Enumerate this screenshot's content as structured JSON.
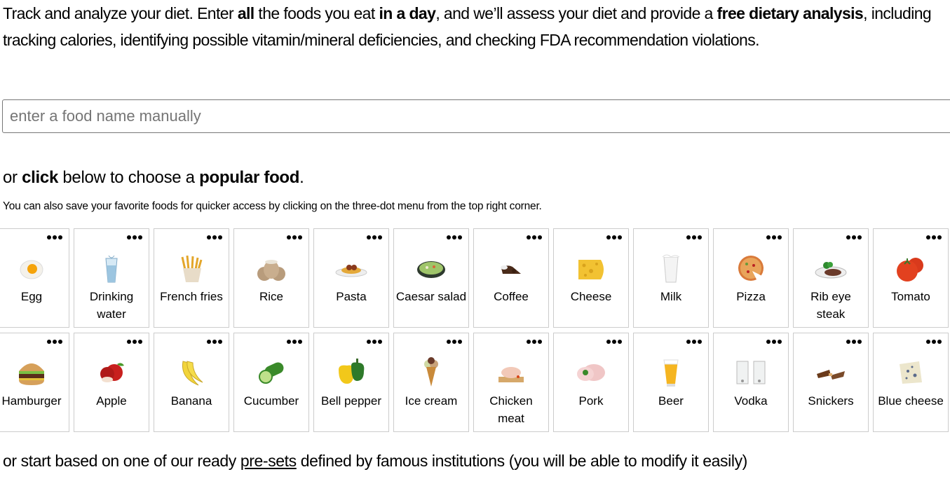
{
  "intro": {
    "part1": "Track and analyze your diet. Enter ",
    "bold1": "all",
    "part2": " the foods you eat ",
    "bold2": "in a day",
    "part3": ", and we’ll assess your diet and provide a ",
    "bold3": "free dietary analysis",
    "part4": ", including tracking calories, identifying possible vitamin/mineral deficiencies, and checking FDA recommendation violations."
  },
  "search": {
    "placeholder": "enter a food name manually",
    "value": ""
  },
  "subhead": {
    "part1": "or ",
    "bold1": "click",
    "part2": " below to choose a ",
    "bold2": "popular food",
    "part3": "."
  },
  "hint": "You can also save your favorite foods for quicker access by clicking on the three-dot menu from the top right corner.",
  "foods": [
    {
      "name": "Egg",
      "icon": "fried-egg"
    },
    {
      "name": "Drinking water",
      "icon": "water-glass"
    },
    {
      "name": "French fries",
      "icon": "french-fries"
    },
    {
      "name": "Rice",
      "icon": "rice-sacks"
    },
    {
      "name": "Pasta",
      "icon": "spaghetti-plate"
    },
    {
      "name": "Caesar salad",
      "icon": "salad-bowl"
    },
    {
      "name": "Coffee",
      "icon": "coffee-beans"
    },
    {
      "name": "Cheese",
      "icon": "cheese-wedge"
    },
    {
      "name": "Milk",
      "icon": "milk-glass"
    },
    {
      "name": "Pizza",
      "icon": "pizza"
    },
    {
      "name": "Rib eye steak",
      "icon": "steak-plate"
    },
    {
      "name": "Tomato",
      "icon": "tomato"
    },
    {
      "name": "Hamburger",
      "icon": "hamburger"
    },
    {
      "name": "Apple",
      "icon": "apple"
    },
    {
      "name": "Banana",
      "icon": "banana"
    },
    {
      "name": "Cucumber",
      "icon": "cucumber"
    },
    {
      "name": "Bell pepper",
      "icon": "bell-pepper"
    },
    {
      "name": "Ice cream",
      "icon": "ice-cream-cone"
    },
    {
      "name": "Chicken meat",
      "icon": "raw-chicken"
    },
    {
      "name": "Pork",
      "icon": "pork-cut"
    },
    {
      "name": "Beer",
      "icon": "beer-glass"
    },
    {
      "name": "Vodka",
      "icon": "shot-glasses"
    },
    {
      "name": "Snickers",
      "icon": "chocolate-bar"
    },
    {
      "name": "Blue cheese",
      "icon": "blue-cheese"
    }
  ],
  "footer": {
    "part1": "or start based on one of our ready ",
    "link": "pre-sets",
    "part2": " defined by famous institutions (you will be able to modify it easily)"
  }
}
